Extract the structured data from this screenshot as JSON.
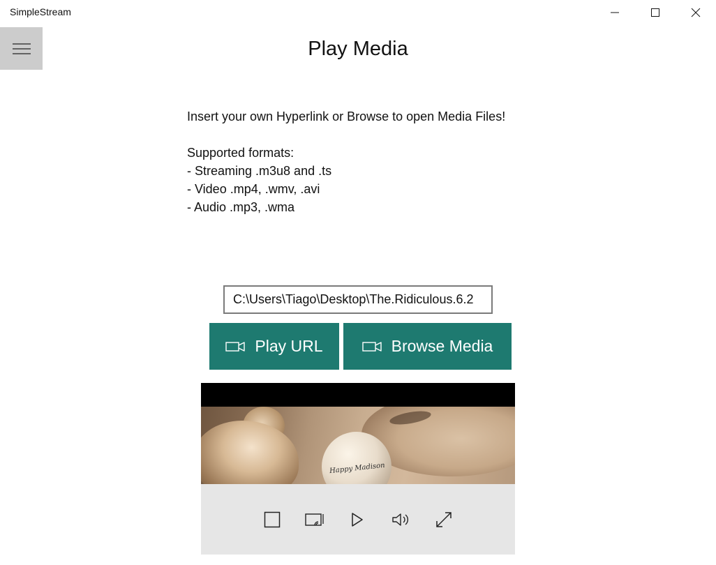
{
  "window": {
    "title": "SimpleStream",
    "minimize_icon": "minimize-icon",
    "maximize_icon": "maximize-icon",
    "close_icon": "close-icon"
  },
  "nav": {
    "menu_icon": "hamburger-menu-icon"
  },
  "page": {
    "title": "Play Media"
  },
  "intro": {
    "line1": "Insert your own Hyperlink or Browse to open Media Files!",
    "formats_heading": "Supported formats:",
    "formats": [
      "- Streaming .m3u8 and .ts",
      "- Video .mp4, .wmv, .avi",
      "- Audio .mp3, .wma"
    ]
  },
  "url_input": {
    "value": "C:\\Users\\Tiago\\Desktop\\The.Ridiculous.6.2"
  },
  "buttons": {
    "play_url_label": "Play URL",
    "browse_media_label": "Browse Media",
    "icon": "video-camera-icon"
  },
  "player": {
    "video_logo_text": "Happy Madison",
    "controls": [
      "stop-icon",
      "cast-icon",
      "play-icon",
      "volume-icon",
      "fullscreen-icon"
    ]
  },
  "colors": {
    "accent": "#1e7a70",
    "hamburger_bg": "#cccccc",
    "player_bg": "#e6e6e6"
  }
}
